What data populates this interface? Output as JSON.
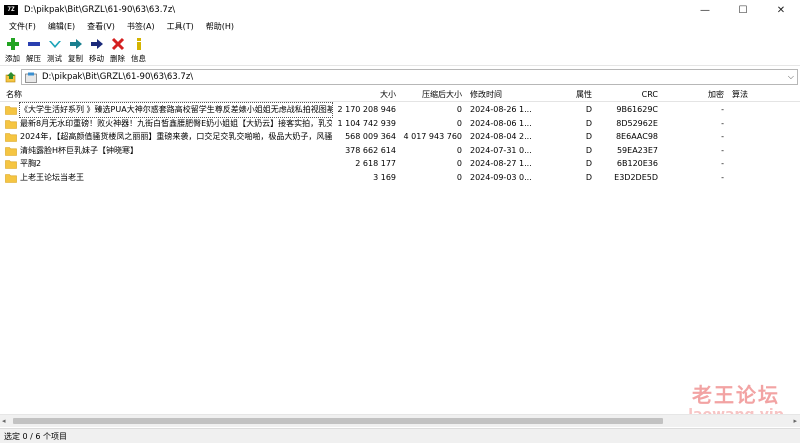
{
  "window": {
    "app_icon_text": "7Z",
    "title": "D:\\pikpak\\Bit\\GRZL\\61-90\\63\\63.7z\\",
    "minimize": "—",
    "maximize": "☐",
    "close": "✕"
  },
  "menu": [
    "文件(F)",
    "编辑(E)",
    "查看(V)",
    "书签(A)",
    "工具(T)",
    "帮助(H)"
  ],
  "toolbar": [
    {
      "label": "添加",
      "icon": "add-icon",
      "color": "#22a422"
    },
    {
      "label": "解压",
      "icon": "extract-icon",
      "color": "#2a3fb0"
    },
    {
      "label": "测试",
      "icon": "test-icon",
      "color": "#1ba3b8"
    },
    {
      "label": "复制",
      "icon": "copy-icon",
      "color": "#1a7f8f"
    },
    {
      "label": "移动",
      "icon": "move-icon",
      "color": "#1b2a7a"
    },
    {
      "label": "删除",
      "icon": "delete-icon",
      "color": "#d42020"
    },
    {
      "label": "信息",
      "icon": "info-icon",
      "color": "#d4b400"
    }
  ],
  "address": {
    "path": "D:\\pikpak\\Bit\\GRZL\\61-90\\63\\63.7z\\"
  },
  "columns": {
    "name": "名称",
    "size": "大小",
    "packed": "压缩后大小",
    "modified": "修改时间",
    "attr": "属性",
    "crc": "CRC",
    "encrypted": "加密",
    "method": "算法"
  },
  "rows": [
    {
      "name": "《大学生活好系列 》臻选PUA大神尔惑套路高校留学生尊反差婊小姐姐无虑战私拍视图基...",
      "size": "2 170 208 946",
      "packed": "0",
      "modified": "2024-08-26 1...",
      "attr": "D",
      "crc": "9B61629C",
      "encrypted": "-"
    },
    {
      "name": "最新8月无水印重磅！败火神器！九街白皙鑫腰肥臀E奶小姐姐【大奶云】接客实拍，乳交...",
      "size": "1 104 742 939",
      "packed": "0",
      "modified": "2024-08-06 1...",
      "attr": "D",
      "crc": "8D52962E",
      "encrypted": "-"
    },
    {
      "name": "2024年，【超高颜值骚货楼凤之丽丽】重磅来袭，口交足交乳交啪啪，极品大奶子，风骚...",
      "size": "568 009 364",
      "packed": "4 017 943 760",
      "modified": "2024-08-04 2...",
      "attr": "D",
      "crc": "8E6AAC98",
      "encrypted": "-"
    },
    {
      "name": "清纯露脸H杯巨乳妹子【钟晓寒】",
      "size": "378 662 614",
      "packed": "0",
      "modified": "2024-07-31 0...",
      "attr": "D",
      "crc": "59EA23E7",
      "encrypted": "-"
    },
    {
      "name": "平胸2",
      "size": "2 618 177",
      "packed": "0",
      "modified": "2024-08-27 1...",
      "attr": "D",
      "crc": "6B120E36",
      "encrypted": "-"
    },
    {
      "name": "上老王论坛当老王",
      "size": "3 169",
      "packed": "0",
      "modified": "2024-09-03 0...",
      "attr": "D",
      "crc": "E3D2DE5D",
      "encrypted": "-"
    }
  ],
  "status": "选定 0 / 6 个项目",
  "watermark": {
    "line1": "老王论坛",
    "line2": "laowang.vip"
  },
  "colors": {
    "folder": "#f5c542",
    "folder_dark": "#d9a21a",
    "accent_up": "#2e8b2e"
  }
}
